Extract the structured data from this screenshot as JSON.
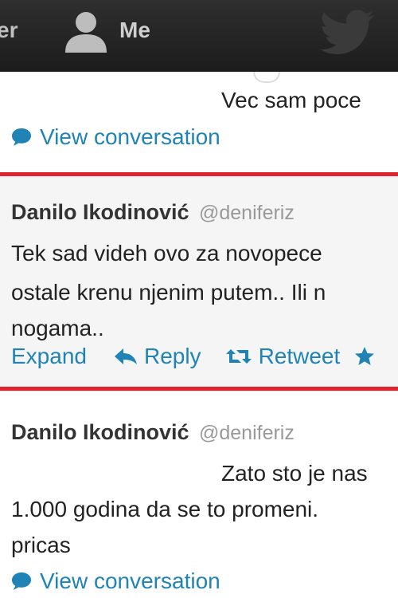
{
  "topbar": {
    "prev_nav_label": "er",
    "me_label": "Me",
    "icons": [
      "person-icon",
      "twitter-bird-icon"
    ]
  },
  "tweets": [
    {
      "text_fragment": "Vec sam poce",
      "view_conversation_label": "View conversation"
    },
    {
      "author_name": "Danilo Ikodinović",
      "author_handle": "@deniferiz",
      "text_lines": [
        "Tek sad videh ovo za novopece",
        "ostale krenu njenim putem.. Ili n",
        "nogama.."
      ],
      "actions": {
        "expand": "Expand",
        "reply": "Reply",
        "retweet": "Retweet"
      }
    },
    {
      "author_name": "Danilo Ikodinović",
      "author_handle": "@deniferiz",
      "text_lines": [
        "Zato sto je nas",
        "1.000 godina da se to promeni.",
        "pricas"
      ],
      "view_conversation_label": "View conversation"
    }
  ],
  "colors": {
    "link": "#1f83b5",
    "highlight_border": "#e0242d",
    "topbar": "#262626"
  }
}
